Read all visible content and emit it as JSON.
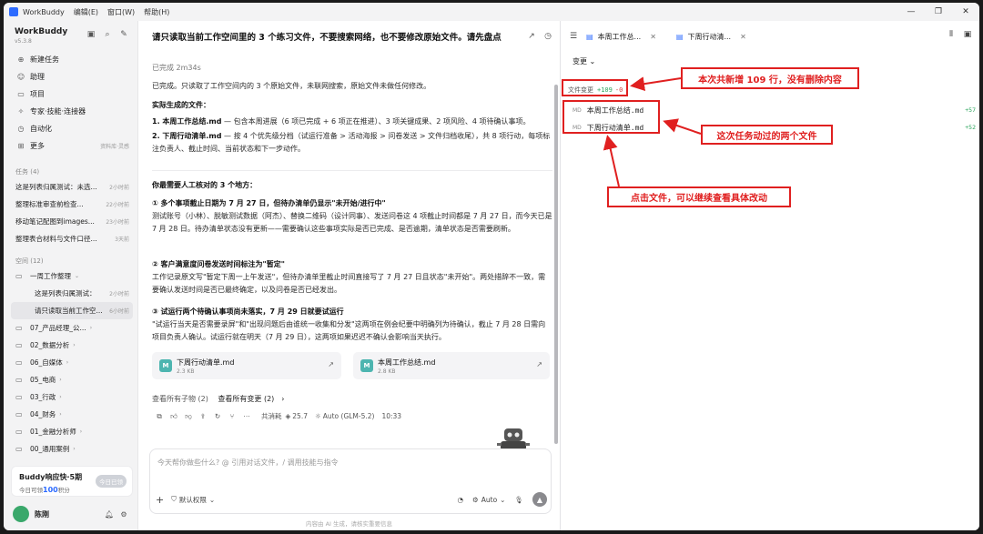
{
  "titlebar": {
    "app_name": "WorkBuddy",
    "menus": [
      "编辑(E)",
      "窗口(W)",
      "帮助(H)"
    ]
  },
  "sidebar": {
    "brand": "WorkBuddy",
    "version": "v5.3.8",
    "nav": [
      {
        "label": "新建任务",
        "icon": "plus-icon"
      },
      {
        "label": "助理",
        "icon": "bot-icon"
      },
      {
        "label": "项目",
        "icon": "folder-icon"
      },
      {
        "label": "专家·技能·连接器",
        "icon": "star-icon"
      },
      {
        "label": "自动化",
        "icon": "clock-icon"
      },
      {
        "label": "更多",
        "icon": "grid-icon",
        "extra": "资料库·灵感"
      }
    ],
    "tasks_header": "任务 (4)",
    "tasks": [
      {
        "title": "这是列表归属测试：未选...",
        "time": "2小时前"
      },
      {
        "title": "整理标准审查前检查...",
        "time": "22小时前"
      },
      {
        "title": "移动笔记配图到images...",
        "time": "23小时前"
      },
      {
        "title": "整理表合材料与文件口径...",
        "time": "3天前"
      }
    ],
    "spaces_header": "空间 (12)",
    "spaces": [
      {
        "title": "一周工作整理",
        "type": "folder"
      },
      {
        "title": "这是列表归属测试：",
        "time": "2小时前",
        "type": "sub"
      },
      {
        "title": "请只读取当前工作空...",
        "time": "6小时前",
        "type": "sub-active"
      },
      {
        "title": "07_产品经理_公...",
        "type": "folder"
      },
      {
        "title": "02_数据分析",
        "type": "folder"
      },
      {
        "title": "06_自媒体",
        "type": "folder"
      },
      {
        "title": "05_电商",
        "type": "folder"
      },
      {
        "title": "03_行政",
        "type": "folder"
      },
      {
        "title": "04_财务",
        "type": "folder"
      },
      {
        "title": "01_金融分析师",
        "type": "folder"
      },
      {
        "title": "00_通用案例",
        "type": "folder"
      }
    ],
    "promo": {
      "title": "Buddy响应快·5期",
      "desc_prefix": "今日可领",
      "desc_value": "100",
      "desc_suffix": "积分",
      "button": "今日已领"
    },
    "user": {
      "name": "陈刚"
    }
  },
  "chat": {
    "title": "请只读取当前工作空间里的 3 个练习文件，不要搜索网络，也不要修改原始文件。请先盘点",
    "status": "已完成 2m34s",
    "intro": "已完成。只读取了工作空间内的 3 个原始文件，未联网搜索，原始文件未做任何修改。",
    "generated_header": "实际生成的文件：",
    "gen1_name": "1. 本周工作总结.md",
    "gen1_desc": " — 包含本周进展（6 项已完成 + 6 项正在推进）、3 项关键成果、2 项风险、4 项待确认事项。",
    "gen2_name": "2. 下周行动清单.md",
    "gen2_desc": " — 按 4 个优先级分档（试运行准备 > 活动海报 > 问卷发送 > 文件归档收尾），共 8 项行动，每项标注负责人、截止时间、当前状态和下一步动作。",
    "check_header": "你最需要人工核对的 3 个地方：",
    "c1_title": "① 多个事项截止日期为 7 月 27 日，但待办清单仍显示\"未开始/进行中\"",
    "c1_body": "测试账号（小林）、脱敏测试数据（阿杰）、替换二维码（设计同事）、发送问卷这 4 项截止时间都是 7 月 27 日，而今天已是 7 月 28 日。待办清单状态没有更新——需要确认这些事项实际是否已完成、是否逾期，清单状态是否需要刷新。",
    "c2_title": "② 客户满意度问卷发送时间标注为\"暂定\"",
    "c2_body": "工作记录原文写\"暂定下周一上午发送\"，但待办清单里截止时间直接写了 7 月 27 日且状态\"未开始\"。两处措辞不一致，需要确认发送时间是否已最终确定，以及问卷是否已经发出。",
    "c3_title": "③ 试运行两个待确认事项尚未落实，7 月 29 日就要试运行",
    "c3_body": "\"试运行当天是否需要录屏\"和\"出现问题后由谁统一收集和分发\"这两项在例会纪要中明确列为待确认，截止 7 月 28 日需向项目负责人确认。试运行就在明天（7 月 29 日），这两项如果迟迟不确认会影响当天执行。",
    "files": [
      {
        "name": "下周行动清单.md",
        "size": "2.3 KB",
        "icon": "M"
      },
      {
        "name": "本周工作总结.md",
        "size": "2.8 KB",
        "icon": "M"
      }
    ],
    "link_children": "查看所有子物 (2)",
    "link_changes": "查看所有变更 (2)",
    "meta_cost": "共消耗",
    "meta_points": "25.7",
    "meta_model": "Auto (GLM-5.2)",
    "meta_time": "10:33",
    "input_placeholder": "今天帮你做些什么? @ 引用对话文件，/ 调用技能与指令",
    "permission": "默认权限",
    "mode": "Auto",
    "footer": "内容由 AI 生成，请核实重要信息"
  },
  "panel": {
    "tabs": [
      {
        "label": "本周工作总..."
      },
      {
        "label": "下周行动清..."
      }
    ],
    "changes_label": "变更",
    "file_changes_label": "文件变更",
    "added": "+109",
    "deleted": "-0",
    "files": [
      {
        "name": "本周工作总结.md",
        "added": "+57"
      },
      {
        "name": "下周行动清单.md",
        "added": "+52"
      }
    ]
  },
  "annotations": {
    "callout1": "本次共新增 109 行，没有删除内容",
    "callout2": "这次任务动过的两个文件",
    "callout3": "点击文件，可以继续查看具体改动",
    "color": "#e02020"
  }
}
